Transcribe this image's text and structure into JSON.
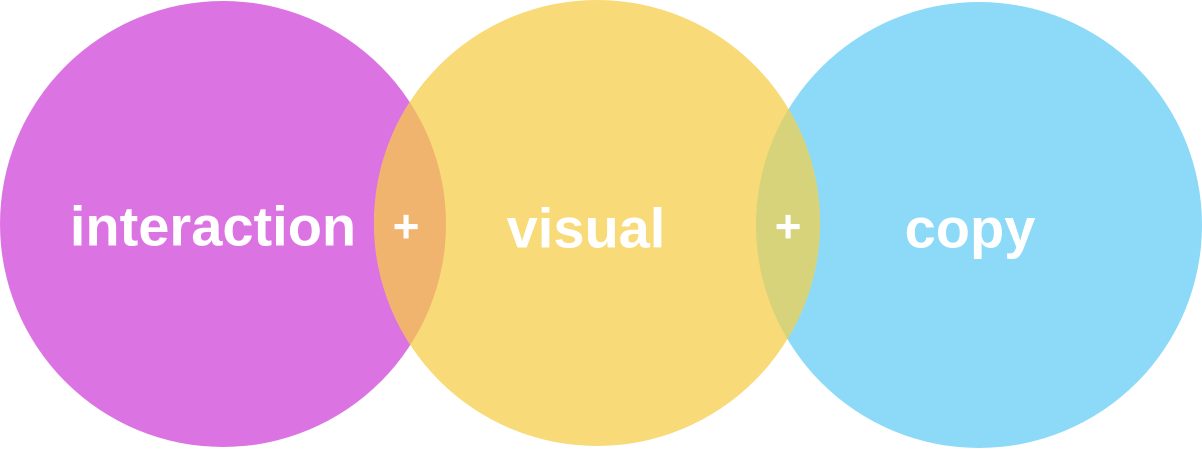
{
  "circles": [
    {
      "id": "interaction",
      "label": "interaction",
      "color": "#dc73e2"
    },
    {
      "id": "visual",
      "label": "visual",
      "color": "#f8da78"
    },
    {
      "id": "copy",
      "label": "copy",
      "color": "#8cdaf8"
    }
  ],
  "overlaps": [
    {
      "between": [
        "interaction",
        "visual"
      ],
      "symbol": "+",
      "color": "#f0b46e"
    },
    {
      "between": [
        "visual",
        "copy"
      ],
      "symbol": "+",
      "color": "#d6d37a"
    }
  ]
}
